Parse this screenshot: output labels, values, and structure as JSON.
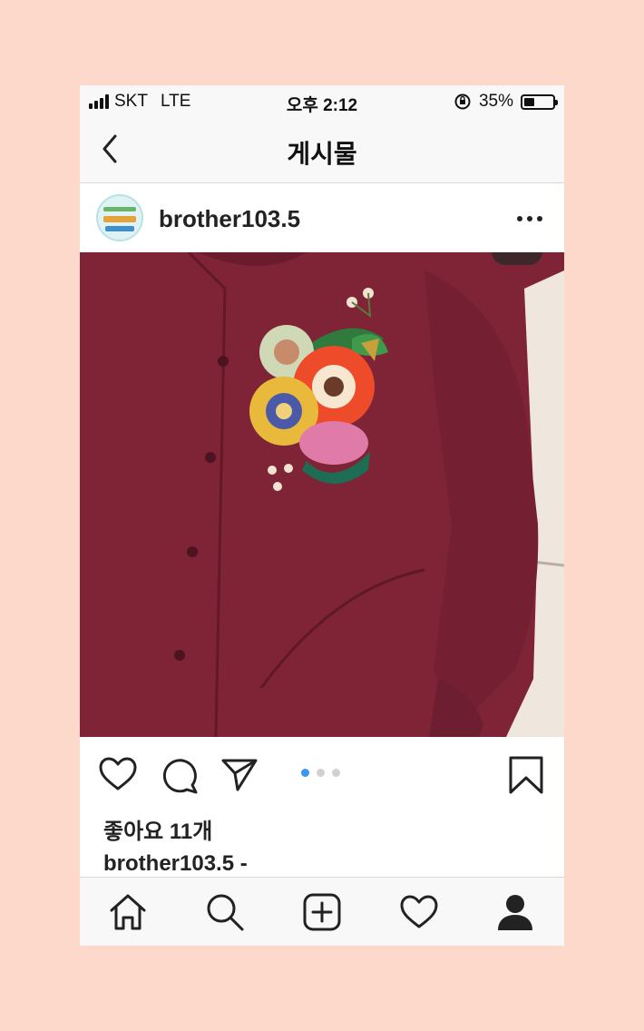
{
  "status_bar": {
    "carrier": "SKT",
    "network": "LTE",
    "time": "오후 2:12",
    "battery_percent": "35%",
    "battery_level": 0.35,
    "icons": [
      "signal-icon",
      "rotation-lock-icon",
      "battery-icon"
    ]
  },
  "nav": {
    "title": "게시물",
    "back_icon": "chevron-left-icon"
  },
  "post": {
    "username": "brother103.5",
    "more_icon": "more-horizontal-icon",
    "photo_description_icon": "photo",
    "carousel": {
      "current_page": 1,
      "total_pages": 3
    },
    "likes_text": "좋아요 11개",
    "caption_text": "brother103.5 -"
  },
  "actions": {
    "icons": [
      "heart-icon",
      "comment-icon",
      "share-icon",
      "bookmark-icon"
    ]
  },
  "tab_bar": {
    "icons": [
      "home-icon",
      "search-icon",
      "add-post-icon",
      "activity-heart-icon",
      "profile-icon"
    ]
  },
  "colors": {
    "background": "#fdd9cc",
    "bar": "#f8f8f8",
    "accent_dot": "#3897f0",
    "shirt": "#7e2436"
  }
}
